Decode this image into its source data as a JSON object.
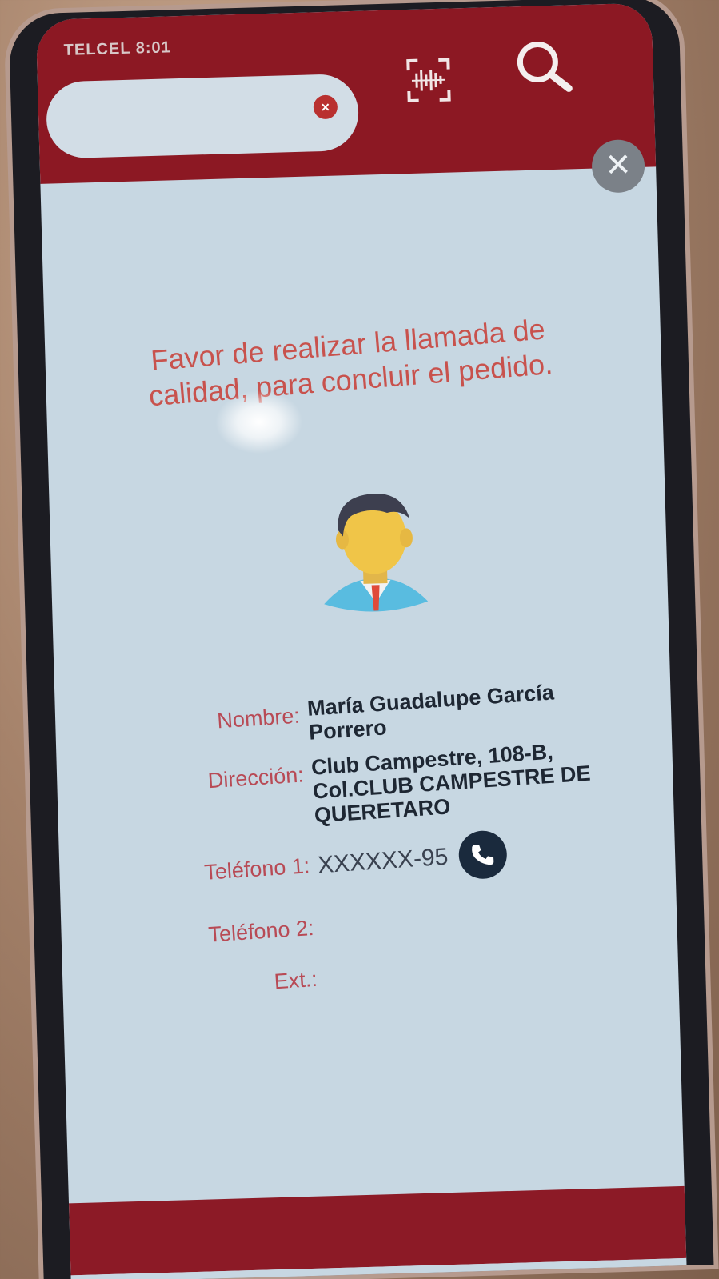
{
  "status_bar": {
    "carrier_time": "TELCEL 8:01"
  },
  "header": {
    "search": {
      "value": "",
      "clear_icon": "close-circle-icon"
    },
    "scan_icon": "barcode-scan-icon",
    "search_icon": "magnifier-icon"
  },
  "dialog": {
    "close_icon": "close-icon",
    "close_symbol": "✕",
    "message": "Favor de realizar la llamada de calidad, para concluir el pedido.",
    "avatar_icon": "person-avatar-icon",
    "fields": {
      "nombre_label": "Nombre:",
      "nombre_value": "María Guadalupe García Porrero",
      "direccion_label": "Dirección:",
      "direccion_value": "Club Campestre, 108-B, Col.CLUB CAMPESTRE DE QUERETARO",
      "telefono1_label": "Teléfono 1:",
      "telefono1_value": "XXXXXX-95",
      "telefono2_label": "Teléfono 2:",
      "telefono2_value": "",
      "ext_label": "Ext.:",
      "ext_value": ""
    },
    "call_icon": "phone-icon"
  },
  "colors": {
    "brand_red": "#8c1823",
    "label_red": "#b84a55",
    "screen_bg": "#c7d7e2",
    "call_button": "#1a2a3d"
  }
}
